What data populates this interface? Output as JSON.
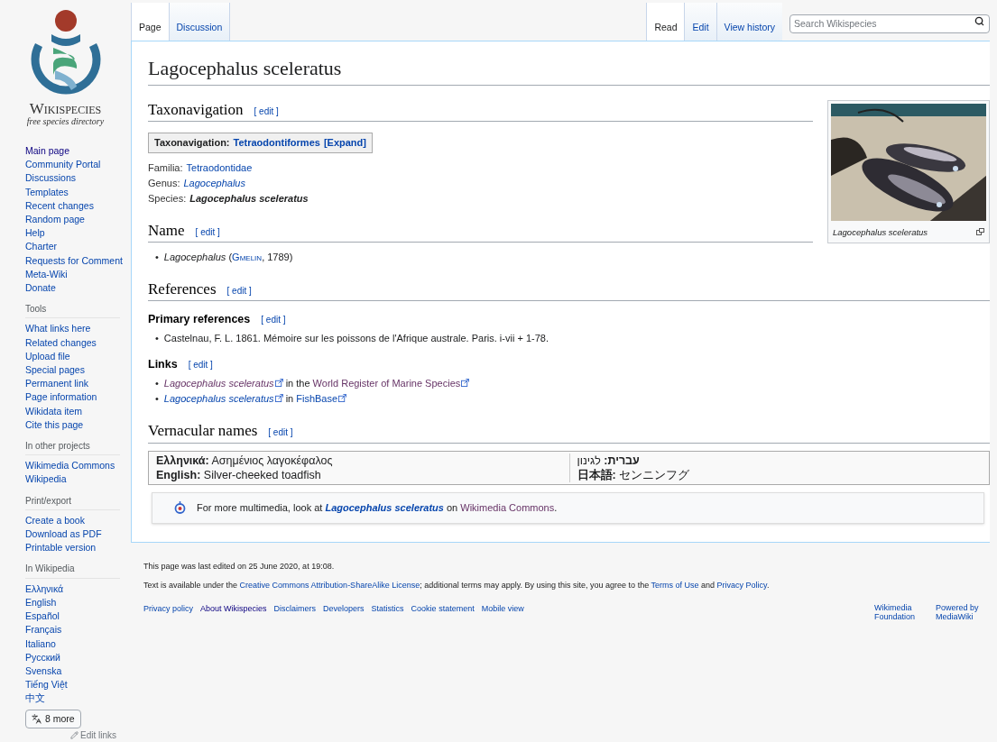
{
  "logo": {
    "wordmark": "Wikispecies",
    "tagline": "free species directory"
  },
  "sidebar": {
    "main": [
      {
        "label": "Main page",
        "visited": true
      },
      {
        "label": "Community Portal",
        "visited": false
      },
      {
        "label": "Discussions",
        "visited": false
      },
      {
        "label": "Templates",
        "visited": false
      },
      {
        "label": "Recent changes",
        "visited": false
      },
      {
        "label": "Random page",
        "visited": false
      },
      {
        "label": "Help",
        "visited": false
      },
      {
        "label": "Charter",
        "visited": false
      },
      {
        "label": "Requests for Comment",
        "visited": false
      },
      {
        "label": "Meta-Wiki",
        "visited": false
      },
      {
        "label": "Donate",
        "visited": false
      }
    ],
    "sections": [
      {
        "heading": "Tools",
        "items": [
          "What links here",
          "Related changes",
          "Upload file",
          "Special pages",
          "Permanent link",
          "Page information",
          "Wikidata item",
          "Cite this page"
        ]
      },
      {
        "heading": "In other projects",
        "items": [
          "Wikimedia Commons",
          "Wikipedia"
        ]
      },
      {
        "heading": "Print/export",
        "items": [
          "Create a book",
          "Download as PDF",
          "Printable version"
        ]
      },
      {
        "heading": "In Wikipedia",
        "items": [
          "Ελληνικά",
          "English",
          "Español",
          "Français",
          "Italiano",
          "Русский",
          "Svenska",
          "Tiếng Việt",
          "中文"
        ]
      }
    ],
    "more_languages": "8 more",
    "edit_links": "Edit links"
  },
  "tabs_left": [
    {
      "label": "Page",
      "selected": true
    },
    {
      "label": "Discussion",
      "selected": false
    }
  ],
  "tabs_right": [
    {
      "label": "Read",
      "selected": true
    },
    {
      "label": "Edit",
      "selected": false
    },
    {
      "label": "View history",
      "selected": false
    }
  ],
  "search": {
    "placeholder": "Search Wikispecies"
  },
  "title": "Lagocephalus sceleratus",
  "bullet": "•",
  "figure": {
    "caption": "Lagocephalus sceleratus"
  },
  "taxonavigation": {
    "heading": "Taxonavigation",
    "edit": "[ edit ]",
    "box_label": "Taxonavigation:",
    "box_link": "Tetraodontiformes",
    "expand": "[Expand]",
    "ranks": [
      {
        "rank": "Familia:",
        "value": "Tetraodontidae",
        "kind": "link"
      },
      {
        "rank": "Genus:",
        "value": "Lagocephalus",
        "kind": "italic-link"
      },
      {
        "rank": "Species:",
        "value": "Lagocephalus sceleratus",
        "kind": "bold-italic"
      }
    ]
  },
  "name_section": {
    "heading": "Name",
    "edit": "[ edit ]",
    "genus": "Lagocephalus",
    "before": "(",
    "author": "Gmelin",
    "after": ", 1789)"
  },
  "references": {
    "heading": "References",
    "edit": "[ edit ]",
    "primary": {
      "heading": "Primary references",
      "edit": "[ edit ]",
      "items": [
        "Castelnau, F. L. 1861. Mémoire sur les poissons de l'Afrique australe. Paris. i-vii + 1-78."
      ]
    },
    "links": {
      "heading": "Links",
      "edit": "[ edit ]",
      "items": [
        {
          "taxon": "Lagocephalus sceleratus",
          "middle": "in the",
          "site": "World Register of Marine Species",
          "visited": true
        },
        {
          "taxon": "Lagocephalus sceleratus",
          "middle": "in",
          "site": "FishBase",
          "visited": false
        }
      ]
    }
  },
  "vernacular": {
    "heading": "Vernacular names",
    "edit": "[ edit ]",
    "columns": [
      [
        {
          "lang": "Ελληνικά:",
          "name": "Ασημένιος λαγοκέφαλος"
        },
        {
          "lang": "English:",
          "name": "Silver-cheeked toadfish"
        }
      ],
      [
        {
          "lang": "עברית:",
          "name": "לגינון"
        },
        {
          "lang": "日本語:",
          "name": "センニンフグ"
        }
      ]
    ]
  },
  "commons": {
    "before": "For more multimedia, look at",
    "taxon": "Lagocephalus sceleratus",
    "middle": "on",
    "site": "Wikimedia Commons",
    "after": "."
  },
  "footer": {
    "last_edited": "This page was last edited on 25 June 2020, at 19:08.",
    "license": [
      {
        "kind": "text",
        "text": "Text is available under the "
      },
      {
        "kind": "link",
        "text": "Creative Commons Attribution-ShareAlike License"
      },
      {
        "kind": "text",
        "text": "; additional terms may apply. By using this site, you agree to the "
      },
      {
        "kind": "link",
        "text": "Terms of Use"
      },
      {
        "kind": "text",
        "text": " and "
      },
      {
        "kind": "link",
        "text": "Privacy Policy"
      },
      {
        "kind": "text",
        "text": "."
      }
    ],
    "links": [
      {
        "label": "Privacy policy",
        "visited": false
      },
      {
        "label": "About Wikispecies",
        "visited": true
      },
      {
        "label": "Disclaimers",
        "visited": false
      },
      {
        "label": "Developers",
        "visited": false
      },
      {
        "label": "Statistics",
        "visited": false
      },
      {
        "label": "Cookie statement",
        "visited": false
      },
      {
        "label": "Mobile view",
        "visited": false
      }
    ],
    "badges": [
      "Wikimedia Foundation",
      "Powered by MediaWiki"
    ]
  }
}
